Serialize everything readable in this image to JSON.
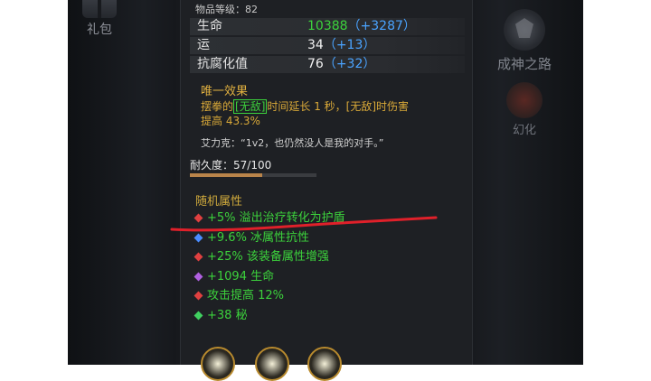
{
  "left_button": {
    "label": "礼包",
    "icon": "gift-icon"
  },
  "right_menu": [
    {
      "label": "成神之路",
      "icon": "crest-icon"
    },
    {
      "label": "幻化",
      "icon": "mask-icon"
    }
  ],
  "item": {
    "level_text": "物品等级：82",
    "stats": [
      {
        "name": "生命",
        "value": "10388",
        "bonus": "（+3287）",
        "value_color": "#3cd23c"
      },
      {
        "name": "运",
        "value": "34",
        "bonus": "（+13）",
        "value_color": "#f2f2f2"
      },
      {
        "name": "抗腐化值",
        "value": "76",
        "bonus": "（+32）",
        "value_color": "#f2f2f2"
      }
    ],
    "unique": {
      "title": "唯一效果",
      "text_1": "摆拳的",
      "kw_1": "[无敌]",
      "text_2": "时间延长 1 秒，[无敌]时伤害",
      "text_3": "提高 43.3%",
      "quote": "艾力克：“1v2，也仍然没人是我的对手。”"
    },
    "durability": {
      "label": "耐久度：57/100",
      "fraction": 0.57
    },
    "random": {
      "title": "随机属性",
      "affixes": [
        {
          "text": "+5% 溢出治疗转化为护盾",
          "gem_color": "#e04040"
        },
        {
          "text": "+9.6% 冰属性抗性",
          "gem_color": "#4a8cff"
        },
        {
          "text": "+25% 该装备属性增强",
          "gem_color": "#e04040"
        },
        {
          "text": "+1094 生命",
          "gem_color": "#b060e0"
        },
        {
          "text": "攻击提高 12%",
          "gem_color": "#e04040"
        },
        {
          "text": "+38 秘",
          "gem_color": "#40d060"
        }
      ]
    }
  },
  "annotation_color": "#e0202a"
}
